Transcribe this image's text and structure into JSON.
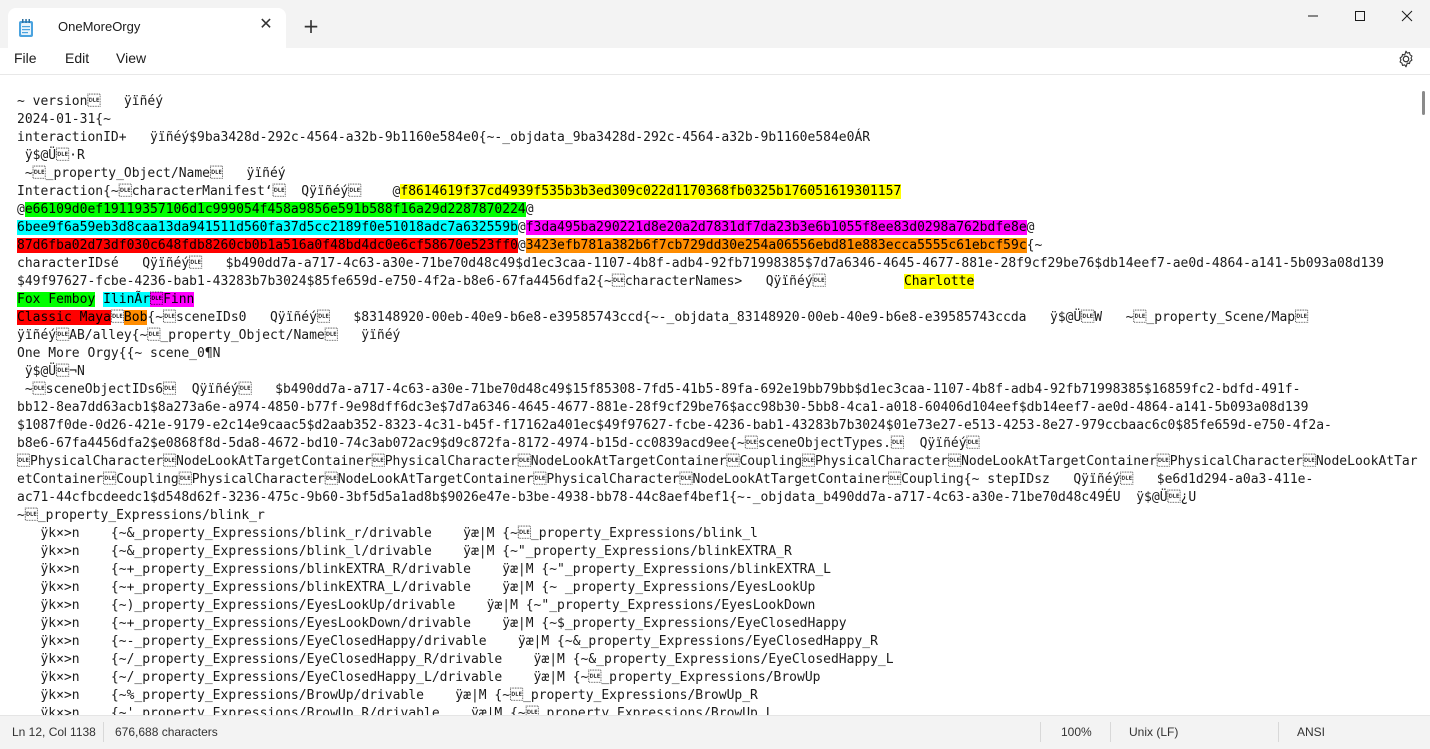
{
  "window": {
    "tab_title": "OneMoreOrgy",
    "close_tab_glyph": "✕",
    "new_tab_glyph": "+",
    "buttons": [
      "minimize-icon",
      "maximize-icon",
      "close-icon"
    ]
  },
  "menu": {
    "file": "File",
    "edit": "Edit",
    "view": "View"
  },
  "editor": {
    "lines": [
      [
        {
          "t": "~ version\u0010   ÿïñéý"
        }
      ],
      [
        {
          "t": "2024-01-31{~"
        }
      ],
      [
        {
          "t": "interactionID+   ÿïñéý$9ba3428d-292c-4564-a32b-9b1160e584e0{~-_objdata_9ba3428d-292c-4564-a32b-9b1160e584e0ÁR"
        }
      ],
      [
        {
          "t": " ÿ$@Ü\u0010·R"
        }
      ],
      [
        {
          "t": " ~\u0010_property_Object/Name\u0010   ÿïñéý"
        }
      ],
      [
        {
          "t": "Interaction{~\u0010characterManifest‘\u0010  Qÿïñéý\u0010    @"
        },
        {
          "t": "f8614619f37cd4939f535b3b3ed309c022d1170368fb0325b176051619301157",
          "c": "#ffff00"
        }
      ],
      [
        {
          "t": "@"
        },
        {
          "t": "e66109d0ef19119357106d1c999054f458a9856e591b588f16a29d2287870224",
          "c": "#00ff00"
        },
        {
          "t": "@"
        }
      ],
      [
        {
          "t": "6bee9f6a59eb3d8caa13da941511d560fa37d5cc2189f0e51018adc7a632559b",
          "c": "#00ffff"
        },
        {
          "t": "@"
        },
        {
          "t": "f3da495ba290221d8e20a2d7831df7da23b3e6b1055f8ee83d0298a762bdfe8e",
          "c": "#ff00ff"
        },
        {
          "t": "@"
        }
      ],
      [
        {
          "t": "87d6fba02d73df030c648fdb8260cb0b1a516a0f48bd4dc0e6cf58670e523ff0",
          "c": "#ff0000"
        },
        {
          "t": "@"
        },
        {
          "t": "3423efb781a382b6f7cb729dd30e254a06556ebd81e883ecca5555c61ebcf59c",
          "c": "#ff8c00"
        },
        {
          "t": "{~"
        }
      ],
      [
        {
          "t": "characterIDsé   Qÿïñéý\u0010   $b490dd7a-a717-4c63-a30e-71be70d48c49$d1ec3caa-1107-4b8f-adb4-92fb71998385$7d7a6346-4645-4677-881e-28f9cf29be76$db14eef7-ae0d-4864-a141-5b093a08d139"
        }
      ],
      [
        {
          "t": "$49f97627-fcbe-4236-bab1-43283b7b3024$85fe659d-e750-4f2a-b8e6-67fa4456dfa2{~\u0010characterNames>   Qÿïñéý\u0010          "
        },
        {
          "t": "Charlotte",
          "c": "#ffff00"
        }
      ],
      [
        {
          "t": "Fox Femboy",
          "c": "#00ff00"
        },
        {
          "t": " "
        },
        {
          "t": "IlinÃr",
          "c": "#00ffff"
        },
        {
          "t": "\u0010",
          "c": "#ff00ff"
        },
        {
          "t": "Finn",
          "c": "#ff00ff"
        }
      ],
      [
        {
          "t": "Classic Maya",
          "c": "#ff0000"
        },
        {
          "t": "\u0010"
        },
        {
          "t": "Bob",
          "c": "#ff8c00"
        },
        {
          "t": "{~\u0010sceneIDs0   Qÿïñéý\u0010   $83148920-00eb-40e9-b6e8-e39585743ccd{~-_objdata_83148920-00eb-40e9-b6e8-e39585743ccda   ÿ$@Ü\u0010W   ~\u0010_property_Scene/Map\u0010"
        }
      ],
      [
        {
          "t": "ÿïñéý\u0010AB/alley{~\u0010_property_Object/Name\u0010   ÿïñéý"
        }
      ],
      [
        {
          "t": "One More Orgy{{~ scene_0¶N"
        }
      ],
      [
        {
          "t": " ÿ$@Ü\u0010¬N"
        }
      ],
      [
        {
          "t": " ~\u0010sceneObjectIDs6\u0010  Qÿïñéý\u0010   $b490dd7a-a717-4c63-a30e-71be70d48c49$15f85308-7fd5-41b5-89fa-692e19bb79bb$d1ec3caa-1107-4b8f-adb4-92fb71998385$16859fc2-bdfd-491f-"
        }
      ],
      [
        {
          "t": "bb12-8ea7dd63acb1$8a273a6e-a974-4850-b77f-9e98dff6dc3e$7d7a6346-4645-4677-881e-28f9cf29be76$acc98b30-5bb8-4ca1-a018-60406d104eef$db14eef7-ae0d-4864-a141-5b093a08d139"
        }
      ],
      [
        {
          "t": "$1087f0de-0d26-421e-9179-e2c14e9caac5$d2aab352-8323-4c31-b45f-f17162a401ec$49f97627-fcbe-4236-bab1-43283b7b3024$01e73e27-e513-4253-8e27-979ccbaac6c0$85fe659d-e750-4f2a-"
        }
      ],
      [
        {
          "t": "b8e6-67fa4456dfa2$e0868f8d-5da8-4672-bd10-74c3ab072ac9$d9c872fa-8172-4974-b15d-cc0839acd9ee{~\u0010sceneObjectTypes.\u0010  Qÿïñéý\u0010"
        }
      ],
      [
        {
          "t": "\u0010PhysicalCharacter\u0010NodeLookAtTargetContainer\u0010PhysicalCharacter\u0010NodeLookAtTargetContainer\u0010Coupling\u0010PhysicalCharacter\u0010NodeLookAtTargetContainer\u0010PhysicalCharacter\u0010NodeLookAtTarg"
        }
      ],
      [
        {
          "t": "etContainer\u0010Coupling\u0010PhysicalCharacter\u0010NodeLookAtTargetContainer\u0010PhysicalCharacter\u0010NodeLookAtTargetContainer\u0010Coupling{~ stepIDsz   Qÿïñéý\u0010   $e6d1d294-a0a3-411e-"
        }
      ],
      [
        {
          "t": "ac71-44cfbcdeedc1$d548d62f-3236-475c-9b60-3bf5d5a1ad8b$9026e47e-b3be-4938-bb78-44c8aef4bef1{~-_objdata_b490dd7a-a717-4c63-a30e-71be70d48c49ÉU  ÿ$@Ü\u0010¿U"
        }
      ],
      [
        {
          "t": "~\u0010_property_Expressions/blink_r"
        }
      ],
      [
        {
          "t": "   ÿk×>n    {~&_property_Expressions/blink_r/drivable    ÿæ|M {~\u0010_property_Expressions/blink_l"
        }
      ],
      [
        {
          "t": "   ÿk×>n    {~&_property_Expressions/blink_l/drivable    ÿæ|M {~\"_property_Expressions/blinkEXTRA_R"
        }
      ],
      [
        {
          "t": "   ÿk×>n    {~+_property_Expressions/blinkEXTRA_R/drivable    ÿæ|M {~\"_property_Expressions/blinkEXTRA_L"
        }
      ],
      [
        {
          "t": "   ÿk×>n    {~+_property_Expressions/blinkEXTRA_L/drivable    ÿæ|M {~ _property_Expressions/EyesLookUp"
        }
      ],
      [
        {
          "t": "   ÿk×>n    {~)_property_Expressions/EyesLookUp/drivable    ÿæ|M {~\"_property_Expressions/EyesLookDown"
        }
      ],
      [
        {
          "t": "   ÿk×>n    {~+_property_Expressions/EyesLookDown/drivable    ÿæ|M {~$_property_Expressions/EyeClosedHappy"
        }
      ],
      [
        {
          "t": "   ÿk×>n    {~-_property_Expressions/EyeClosedHappy/drivable    ÿæ|M {~&_property_Expressions/EyeClosedHappy_R"
        }
      ],
      [
        {
          "t": "   ÿk×>n    {~/_property_Expressions/EyeClosedHappy_R/drivable    ÿæ|M {~&_property_Expressions/EyeClosedHappy_L"
        }
      ],
      [
        {
          "t": "   ÿk×>n    {~/_property_Expressions/EyeClosedHappy_L/drivable    ÿæ|M {~\u0010_property_Expressions/BrowUp"
        }
      ],
      [
        {
          "t": "   ÿk×>n    {~%_property_Expressions/BrowUp/drivable    ÿæ|M {~\u0010_property_Expressions/BrowUp_R"
        }
      ],
      [
        {
          "t": "   ÿk×>n    {~'_property_Expressions/BrowUp_R/drivable    ÿæ|M {~\u0010_property_Expressions/BrowUp_L"
        }
      ]
    ]
  },
  "status": {
    "position": "Ln 12, Col 1138",
    "characters": "676,688 characters",
    "zoom": "100%",
    "line_ending": "Unix (LF)",
    "encoding": "ANSI"
  }
}
